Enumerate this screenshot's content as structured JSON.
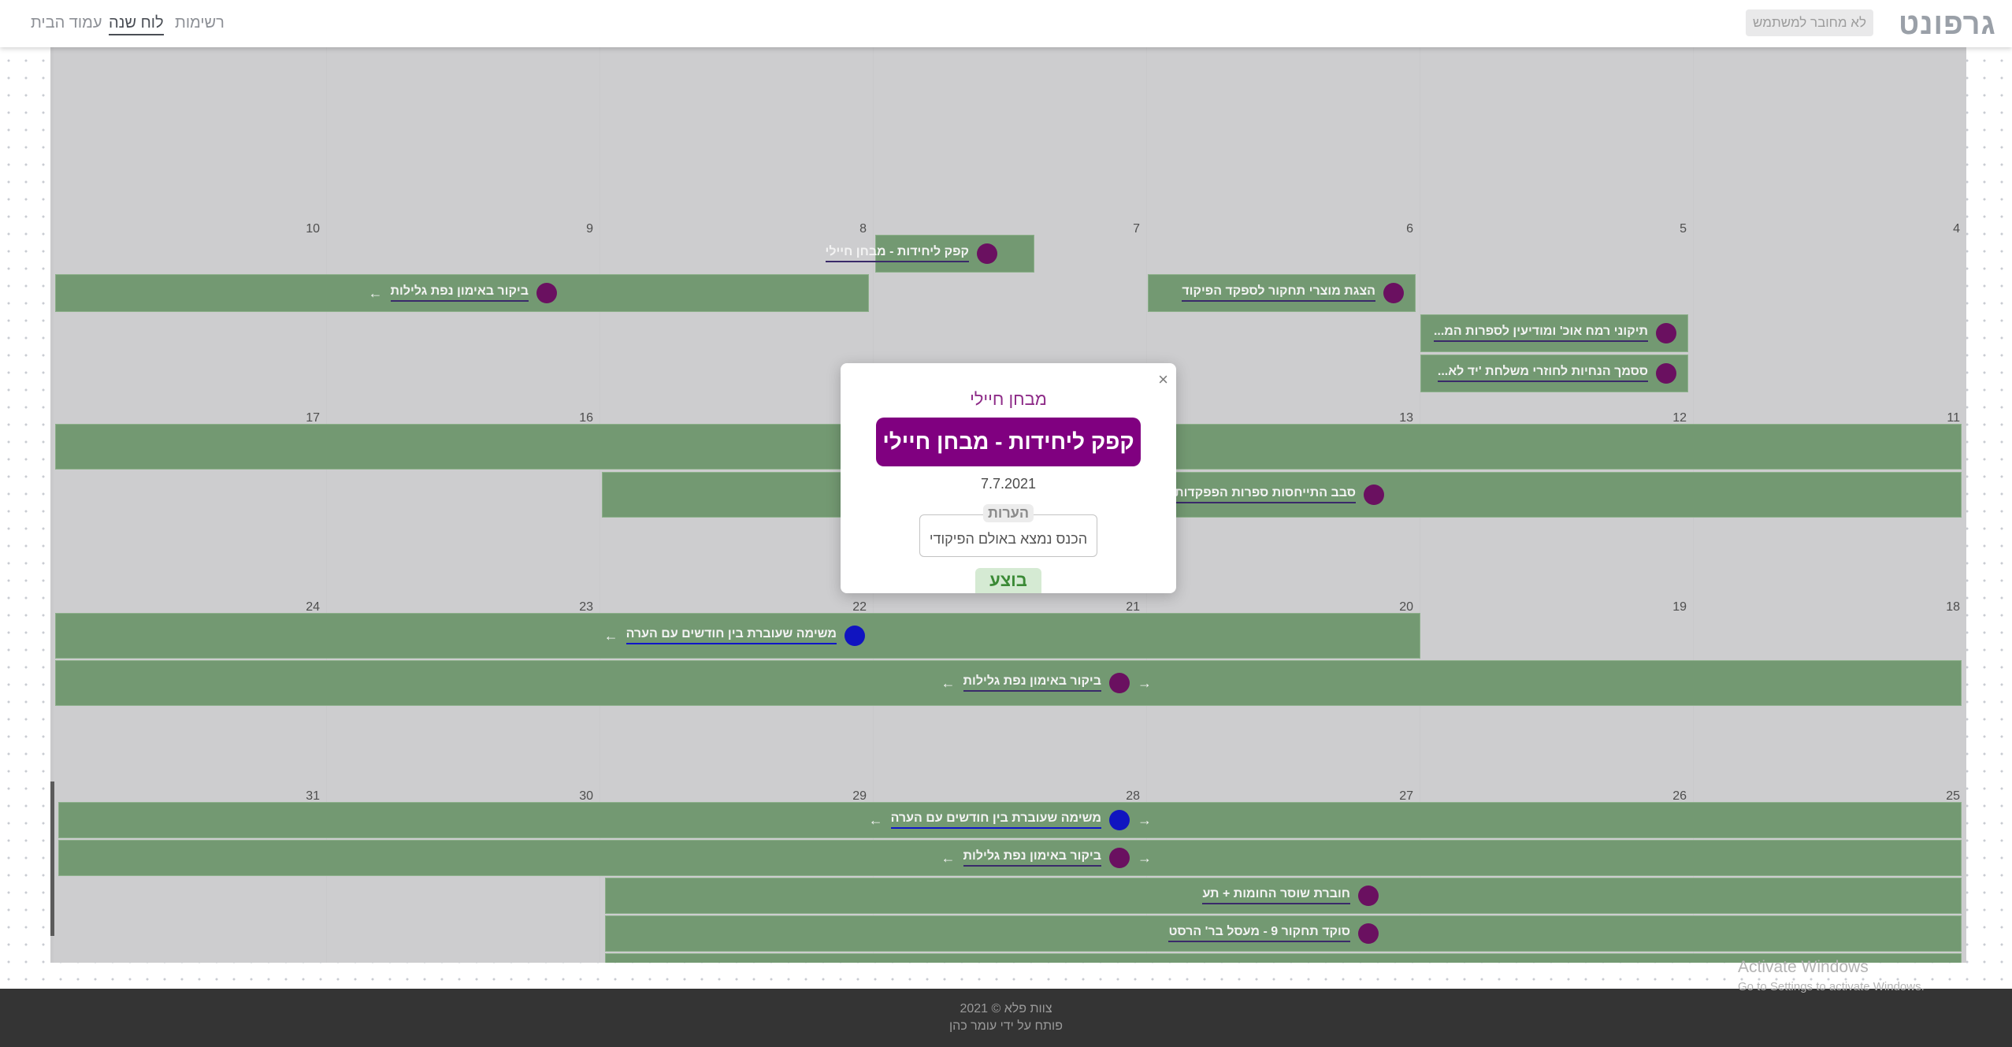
{
  "app": {
    "logo": "גרפונט",
    "login_button": "לא מחובר למשתמש",
    "nav": [
      "רשימות",
      "לוח שנה",
      "עמוד הבית"
    ],
    "active_nav": "לוח שנה"
  },
  "calendar": {
    "weeks": [
      {
        "days": [
          "",
          "",
          "",
          "",
          "",
          "",
          ""
        ]
      },
      {
        "days": [
          "4",
          "5",
          "6",
          "7",
          "8",
          "9",
          "10"
        ]
      },
      {
        "days": [
          "11",
          "12",
          "13",
          "",
          "",
          "16",
          "17"
        ]
      },
      {
        "days": [
          "18",
          "19",
          "20",
          "21",
          "22",
          "23",
          "24"
        ]
      },
      {
        "days": [
          "25",
          "26",
          "27",
          "28",
          "29",
          "30",
          "31"
        ]
      }
    ],
    "events": [
      {
        "title": "קפק ליחידות - מבחן חיילי",
        "dot": "purple"
      },
      {
        "title": "ביקור באימון נפת גלילות",
        "dot": "purple"
      },
      {
        "title": "הצגת מוצרי תחקור לספקד הפיקוד",
        "dot": "purple"
      },
      {
        "title": "תיקוני רמח אוכ' ומודיעין לספרות המ...",
        "dot": "purple"
      },
      {
        "title": "ססמך הנחיות לחוזרי משלחת 'יד לא...",
        "dot": "purple"
      },
      {
        "title": "סבב התייחסות ספרות הפפקדות",
        "dot": "purple"
      },
      {
        "title": "משימה שעוברת בין חודשים עם הערה",
        "dot": "blue"
      },
      {
        "title": "ביקור באימון נפת גלילות",
        "dot": "purple"
      },
      {
        "title": "משימה שעוברת בין חודשים עם הערה",
        "dot": "blue"
      },
      {
        "title": "ביקור באימון נפת גלילות",
        "dot": "purple"
      },
      {
        "title": "חוברת שוסר החומות + תע",
        "dot": "purple"
      },
      {
        "title": "סוקד תחקור 9 - מעסל בר' הרסט",
        "dot": "purple"
      }
    ],
    "arrows": {
      "left": "←",
      "right": "→"
    }
  },
  "modal": {
    "category": "מבחן חיילי",
    "title": "קפק ליחידות - מבחן חיילי",
    "date": "7.7.2021",
    "notes_label": "הערות",
    "notes": "הכנס נמצא באולם הפיקודי",
    "status": "בוצע",
    "close": "×"
  },
  "footer": {
    "line1": "צוות פלא © 2021",
    "line2": "פותח על ידי עומר כהן"
  },
  "watermark": {
    "line1": "Activate Windows",
    "line2": "Go to Settings to activate Windows."
  },
  "colors": {
    "event_green": "#739972",
    "accent_purple": "#800080",
    "status_green": "#3b8a36"
  }
}
